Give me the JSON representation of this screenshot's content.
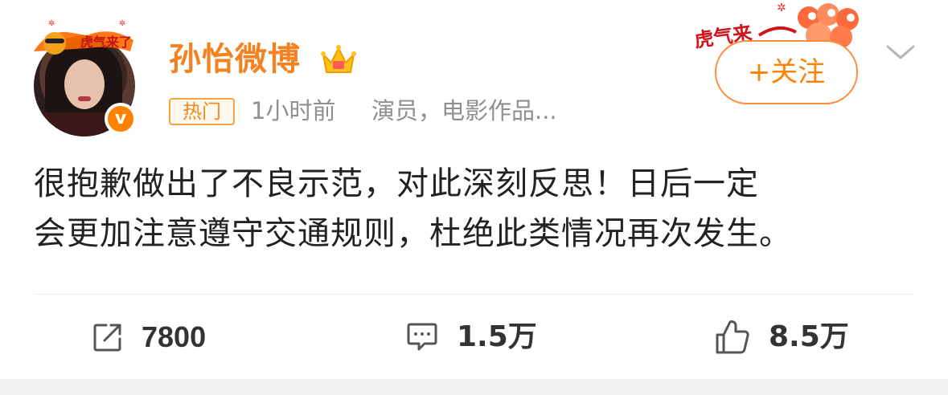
{
  "post": {
    "author": {
      "name": "孙怡微博",
      "verified_badge": "v",
      "hot_tag": "热门"
    },
    "meta": {
      "time": "1小时前",
      "source": "演员，电影作品..."
    },
    "follow_label": "+关注",
    "content_lines": [
      "很抱歉做出了不良示范，对此深刻反思！日后一定",
      "会更加注意遵守交通规则，杜绝此类情况再次发生。"
    ],
    "actions": {
      "repost_count": "7800",
      "comment_count": "1.5万",
      "like_count": "8.5万"
    }
  },
  "colors": {
    "accent": "#ff8200",
    "username": "#f58220",
    "meta_text": "#8f8f8f"
  },
  "icons": [
    "avatar-pendant-decoration",
    "verified-icon",
    "crown-icon",
    "chevron-down-icon",
    "repost-icon",
    "comment-icon",
    "like-icon"
  ]
}
